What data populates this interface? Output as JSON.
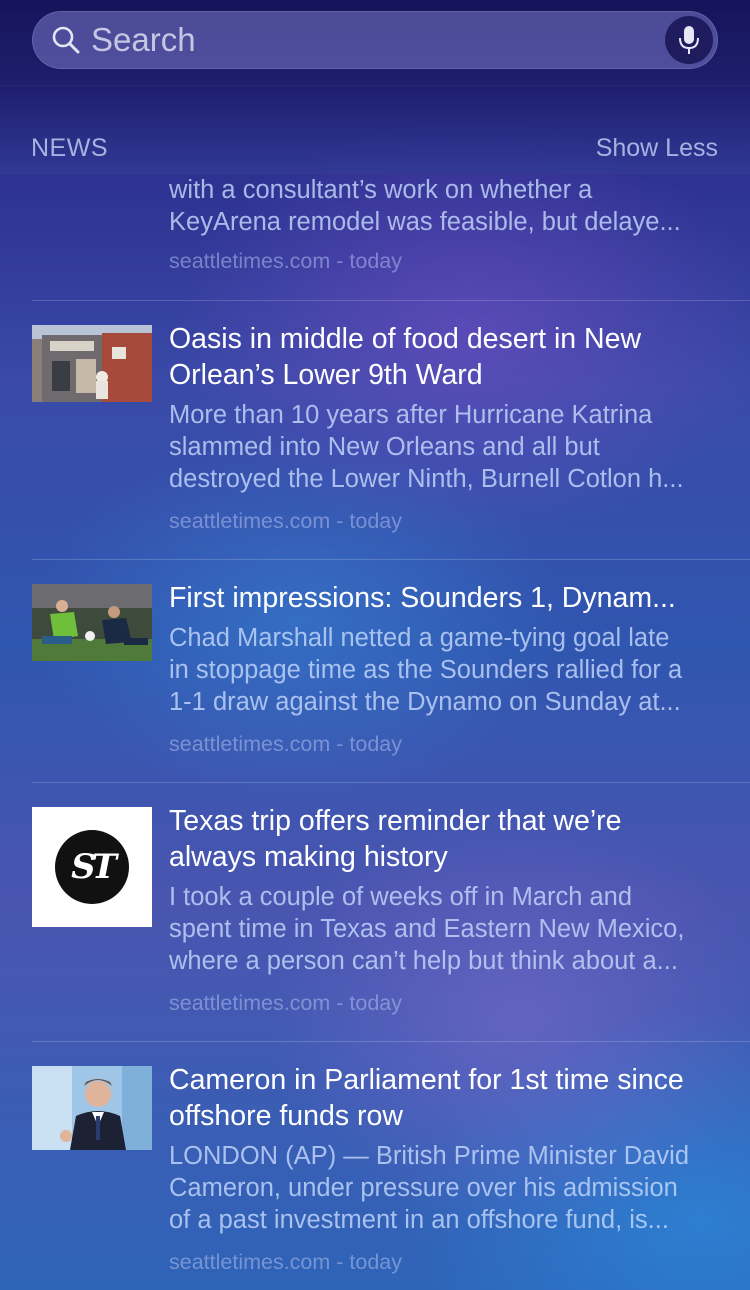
{
  "search": {
    "placeholder": "Search"
  },
  "section": {
    "title": "NEWS",
    "toggle_label": "Show Less"
  },
  "partial_item": {
    "body_line_1": "with a consultant’s work on whether a",
    "body_line_2": "KeyArena remodel was feasible, but delaye...",
    "source": "seattletimes.com - today"
  },
  "items": [
    {
      "title_line_1": "Oasis in middle of food desert in New",
      "title_line_2": "Orlean’s Lower 9th Ward",
      "body_line_1": "More than 10 years after Hurricane Katrina",
      "body_line_2": "slammed into New Orleans and all but",
      "body_line_3": "destroyed the Lower Ninth, Burnell Cotlon h...",
      "source": "seattletimes.com - today"
    },
    {
      "title_line_1": "First impressions: Sounders 1, Dynam...",
      "body_line_1": "Chad Marshall netted a game-tying goal late",
      "body_line_2": "in stoppage time as the Sounders rallied for a",
      "body_line_3": "1-1 draw against the Dynamo on Sunday at...",
      "source": "seattletimes.com - today"
    },
    {
      "title_line_1": "Texas trip offers reminder that we’re",
      "title_line_2": "always making history",
      "body_line_1": "I took a couple of weeks off in March and",
      "body_line_2": "spent time in Texas and Eastern New Mexico,",
      "body_line_3": "where a person can’t help but think about a...",
      "source": "seattletimes.com - today",
      "logo_text": "ST"
    },
    {
      "title_line_1": "Cameron in Parliament for 1st time since",
      "title_line_2": "offshore funds row",
      "body_line_1": "LONDON (AP) — British Prime Minister David",
      "body_line_2": "Cameron, under pressure over his admission",
      "body_line_3": "of a past investment in an offshore fund, is...",
      "source": "seattletimes.com - today"
    }
  ],
  "icons": {
    "search": "search-icon",
    "mic": "microphone-icon"
  }
}
